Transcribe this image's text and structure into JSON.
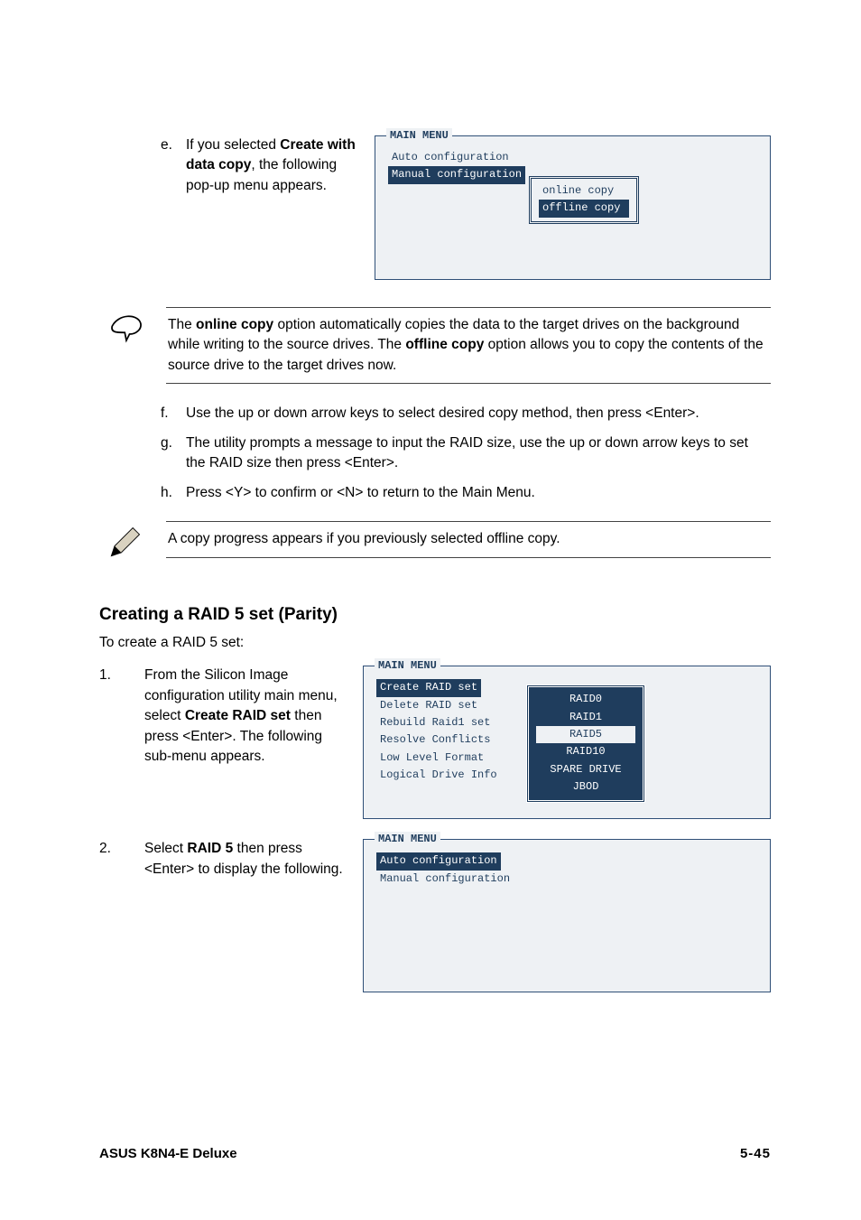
{
  "step_e": {
    "letter": "e.",
    "pre": "If you selected ",
    "bold": "Create with data copy",
    "post": ", the following pop-up menu appears."
  },
  "console1": {
    "title": "MAIN MENU",
    "item1": "Auto configuration",
    "item2": "Manual configuration",
    "popup1": "online copy",
    "popup2": "offline copy"
  },
  "note1": {
    "p1a": "The ",
    "p1b": "online copy",
    "p1c": " option automatically copies the data to the target drives on the background while writing to the source drives. The ",
    "p1d": "offline copy",
    "p1e": " option allows you to copy the contents of the source drive to the target drives now."
  },
  "step_f": {
    "letter": "f.",
    "text": "Use the up or down arrow keys to select desired copy method, then press <Enter>."
  },
  "step_g": {
    "letter": "g.",
    "text": "The utility prompts a message to input the RAID size, use the up or down arrow keys to set the RAID size then press <Enter>."
  },
  "step_h": {
    "letter": "h.",
    "text": "Press <Y> to confirm or <N> to return to the Main Menu."
  },
  "note2": {
    "text": "A copy progress appears if you previously selected offline copy."
  },
  "heading": "Creating a RAID 5 set (Parity)",
  "intro": "To create a RAID 5 set:",
  "step1": {
    "num": "1.",
    "pre": "From the Silicon Image configuration utility main menu, select ",
    "bold": "Create RAID set",
    "post": " then press <Enter>. The following sub-menu appears."
  },
  "console2": {
    "title": "MAIN MENU",
    "m1": "Create RAID set",
    "m2": "Delete RAID set",
    "m3": "Rebuild Raid1 set",
    "m4": "Resolve Conflicts",
    "m5": "Low Level Format",
    "m6": "Logical Drive Info",
    "p1": "RAID0",
    "p2": "RAID1",
    "p3": "RAID5",
    "p4": "RAID10",
    "p5": "SPARE DRIVE",
    "p6": "JBOD"
  },
  "step2": {
    "num": "2.",
    "pre": "Select ",
    "bold": "RAID 5",
    "post": " then press <Enter> to display the following."
  },
  "console3": {
    "title": "MAIN MENU",
    "item1": "Auto configuration",
    "item2": "Manual configuration"
  },
  "footer": {
    "left": "ASUS K8N4-E Deluxe",
    "right": "5-45"
  }
}
